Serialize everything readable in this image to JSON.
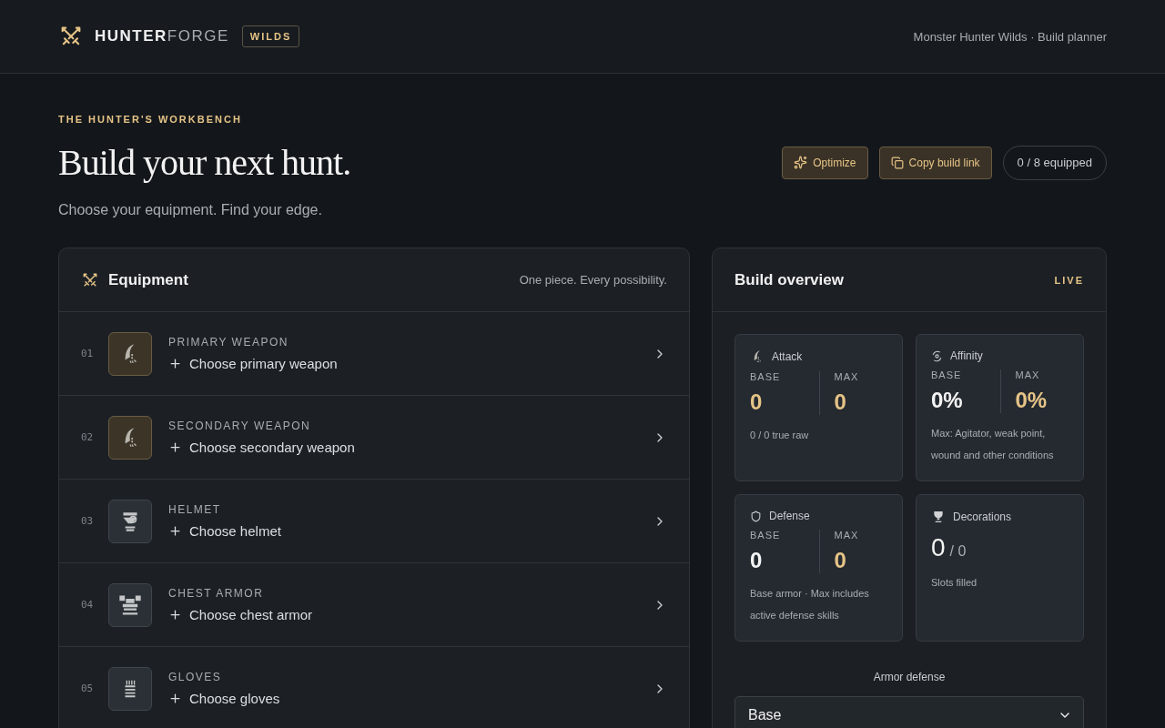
{
  "header": {
    "brand_strong": "HUNTER",
    "brand_light": "FORGE",
    "badge": "WILDS",
    "tagline": "Monster Hunter Wilds · Build planner"
  },
  "hero": {
    "eyebrow": "THE HUNTER'S WORKBENCH",
    "title": "Build your next hunt.",
    "subtitle": "Choose your equipment. Find your edge.",
    "actions": [
      {
        "kind": "optimize",
        "label": "Optimize"
      },
      {
        "kind": "copy",
        "label": "Copy build link"
      }
    ],
    "equipped": "0 / 8 equipped"
  },
  "equipment": {
    "title": "Equipment",
    "note": "One piece. Every possibility.",
    "slots": [
      {
        "number": "01",
        "kind": "weapon",
        "label": "PRIMARY WEAPON",
        "action": "Choose primary weapon"
      },
      {
        "number": "02",
        "kind": "weapon",
        "label": "SECONDARY WEAPON",
        "action": "Choose secondary weapon"
      },
      {
        "number": "03",
        "kind": "helmet",
        "label": "HELMET",
        "action": "Choose helmet"
      },
      {
        "number": "04",
        "kind": "chest",
        "label": "CHEST ARMOR",
        "action": "Choose chest armor"
      },
      {
        "number": "05",
        "kind": "gloves",
        "label": "GLOVES",
        "action": "Choose gloves"
      }
    ]
  },
  "overview": {
    "title": "Build overview",
    "live": "LIVE",
    "stats": [
      {
        "kind": "split",
        "title": "Attack",
        "base_label": "BASE",
        "base": "0",
        "base_accent": true,
        "max_label": "MAX",
        "max": "0",
        "note": "0 / 0 true raw"
      },
      {
        "kind": "split",
        "title": "Affinity",
        "base_label": "BASE",
        "base": "0%",
        "base_accent": false,
        "max_label": "MAX",
        "max": "0%",
        "note": "Max: Agitator, weak point, wound and other conditions"
      },
      {
        "kind": "split",
        "title": "Defense",
        "base_label": "BASE",
        "base": "0",
        "base_accent": false,
        "max_label": "MAX",
        "max": "0",
        "note": "Base armor · Max includes active defense skills"
      },
      {
        "kind": "count",
        "title": "Decorations",
        "count": "0",
        "total": "/ 0",
        "note": "Slots filled"
      }
    ],
    "armor_label": "Armor defense",
    "armor_value": "Base"
  }
}
